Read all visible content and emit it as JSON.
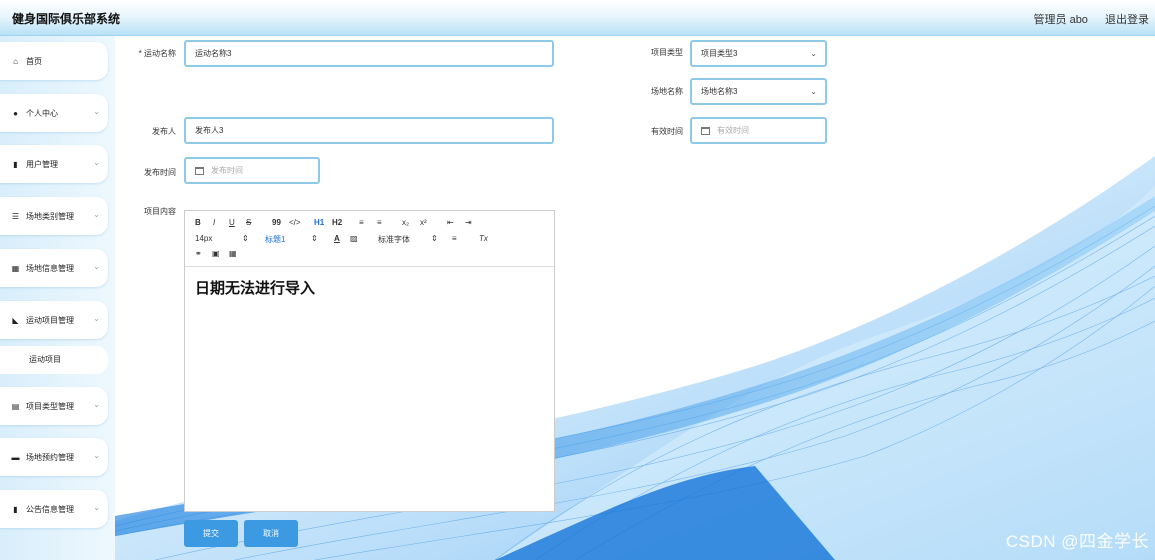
{
  "app": {
    "title": "健身国际俱乐部系统"
  },
  "header": {
    "user": "管理员 abo",
    "logout": "退出登录"
  },
  "sidebar": {
    "items": [
      {
        "label": "首页",
        "icon": "home-icon"
      },
      {
        "label": "个人中心",
        "icon": "user-icon"
      },
      {
        "label": "用户管理",
        "icon": "users-icon"
      },
      {
        "label": "场地类别管理",
        "icon": "list-icon"
      },
      {
        "label": "场地信息管理",
        "icon": "grid-icon"
      },
      {
        "label": "运动项目管理",
        "icon": "thumb-icon"
      },
      {
        "label": "运动项目",
        "icon": ""
      },
      {
        "label": "项目类型管理",
        "icon": "book-icon"
      },
      {
        "label": "场地预约管理",
        "icon": "calendar-icon"
      },
      {
        "label": "公告信息管理",
        "icon": "notice-icon"
      }
    ]
  },
  "form": {
    "sport_name_label": "运动名称",
    "required_mark": "*",
    "sport_name_value": "运动名称3",
    "type_label": "项目类型",
    "type_value": "项目类型3",
    "venue_label": "场地名称",
    "venue_value": "场地名称3",
    "publisher_label": "发布人",
    "publisher_value": "发布人3",
    "valid_time_label": "有效时间",
    "valid_time_placeholder": "有效时间",
    "publish_time_label": "发布时间",
    "publish_time_placeholder": "发布时间",
    "content_label": "项目内容",
    "content_text": "日期无法进行导入"
  },
  "editor_toolbar": {
    "bold": "B",
    "italic": "I",
    "underline": "U",
    "strike": "S",
    "quote": "99",
    "code": "</>",
    "h1": "H1",
    "h2": "H2",
    "ol": "≡",
    "ul": "≡",
    "sub": "x₂",
    "sup": "x²",
    "indent_left": "⇤",
    "indent_right": "⇥",
    "size": "14px",
    "heading": "标题1",
    "font": "标准字体",
    "color": "A",
    "bg": "▨",
    "align": "≡",
    "clear": "Tx",
    "link": "🔗",
    "image": "▣",
    "video": "▦"
  },
  "buttons": {
    "submit": "提交",
    "cancel": "取消"
  },
  "watermark": "CSDN @四金学长",
  "colors": {
    "accent": "#3b9ae1",
    "border": "#8ec9ea",
    "header_grad": "#b8e1f6"
  }
}
